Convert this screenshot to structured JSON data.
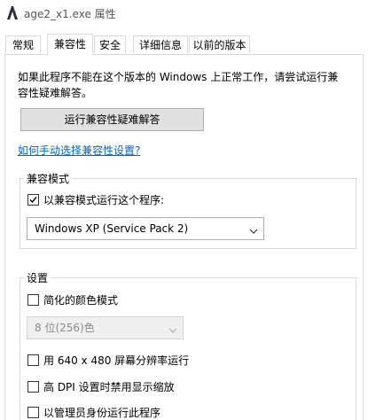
{
  "window": {
    "title": "age2_x1.exe 属性",
    "app_icon": "app-exe-icon"
  },
  "tabs": [
    {
      "label": "常规",
      "active": false
    },
    {
      "label": "兼容性",
      "active": true
    },
    {
      "label": "安全",
      "active": false
    },
    {
      "label": "详细信息",
      "active": false
    },
    {
      "label": "以前的版本",
      "active": false
    }
  ],
  "compat": {
    "intro_line1": "如果此程序不能在这个版本的 Windows 上正常工作，请尝试运行兼",
    "intro_line2": "容性疑难解答。",
    "troubleshooter_button": "运行兼容性疑难解答",
    "manual_link": "如何手动选择兼容性设置?",
    "mode_group": {
      "label": "兼容模式",
      "checkbox_label": "以兼容模式运行这个程序:",
      "checked": true,
      "select_value": "Windows XP (Service Pack 2)"
    },
    "settings_group": {
      "label": "设置",
      "reduced_color": {
        "label": "简化的颜色模式",
        "checked": false
      },
      "color_select_value": "8 位(256)色",
      "res_640": {
        "label": "用 640 x 480 屏幕分辨率运行",
        "checked": false
      },
      "dpi": {
        "label": "高 DPI 设置时禁用显示缩放",
        "checked": false
      },
      "admin": {
        "label": "以管理员身份运行此程序",
        "checked": false
      }
    }
  },
  "colors": {
    "link": "#0066cc",
    "button_bg": "#e1e1e1"
  }
}
